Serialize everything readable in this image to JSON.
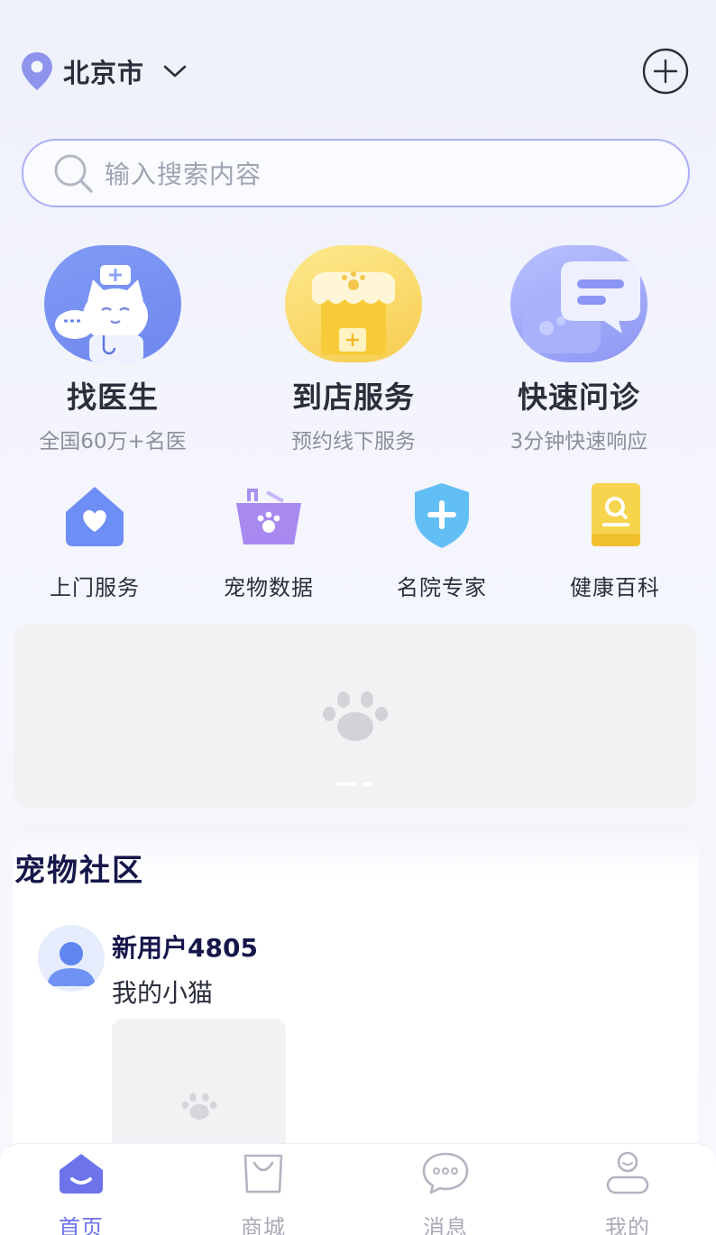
{
  "header": {
    "city": "北京市"
  },
  "search": {
    "placeholder": "输入搜索内容"
  },
  "big_services": [
    {
      "title": "找医生",
      "subtitle": "全国60万+名医"
    },
    {
      "title": "到店服务",
      "subtitle": "预约线下服务"
    },
    {
      "title": "快速问诊",
      "subtitle": "3分钟快速响应"
    }
  ],
  "small_services": [
    {
      "label": "上门服务"
    },
    {
      "label": "宠物数据"
    },
    {
      "label": "名院专家"
    },
    {
      "label": "健康百科"
    }
  ],
  "community": {
    "title": "宠物社区",
    "post": {
      "username": "新用户4805",
      "text": "我的小猫"
    }
  },
  "tabs": [
    {
      "label": "首页",
      "active": true
    },
    {
      "label": "商城",
      "active": false
    },
    {
      "label": "消息",
      "active": false
    },
    {
      "label": "我的",
      "active": false
    }
  ],
  "colors": {
    "accent": "#6d73ea",
    "search_border": "#a9b0f3",
    "title_dark": "#15174a"
  }
}
